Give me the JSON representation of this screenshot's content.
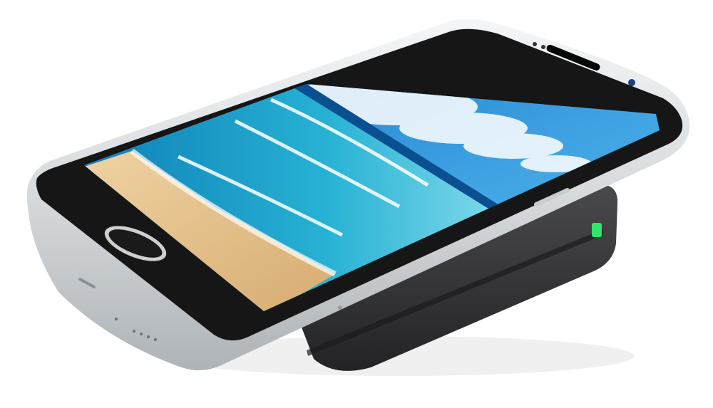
{
  "scene": {
    "subject": "smartphone-on-wireless-charging-pad",
    "background_color": "#ffffff",
    "phone": {
      "frame_color": "#d9dde0",
      "face_color": "#151515",
      "home_button_ring_color": "#cfcfcf",
      "screen_wallpaper": "beach-and-ocean",
      "sand_color": "#e4c190",
      "sea_color": "#1fa3c8",
      "sky_color": "#3aa9ea"
    },
    "charger": {
      "body_color": "#3a3a3c",
      "led_color": "#2ee66b",
      "led_state": "on"
    }
  }
}
